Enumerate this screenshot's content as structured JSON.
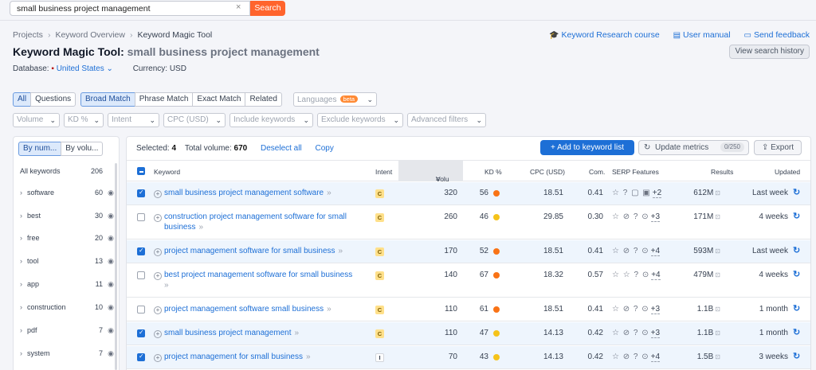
{
  "search": {
    "value": "small business project management",
    "clear": "×",
    "button": "Search"
  },
  "breadcrumb": [
    "Projects",
    "Keyword Overview",
    "Keyword Magic Tool"
  ],
  "links": {
    "course": "Keyword Research course",
    "manual": "User manual",
    "feedback": "Send feedback"
  },
  "title": {
    "prefix": "Keyword Magic Tool:",
    "keyword": "small business project management"
  },
  "history_button": "View search history",
  "database": {
    "label": "Database:",
    "value": "United States",
    "currency": "Currency: USD"
  },
  "match_tabs": [
    "All",
    "Questions",
    "Broad Match",
    "Phrase Match",
    "Exact Match",
    "Related"
  ],
  "languages": {
    "label": "Languages",
    "badge": "beta"
  },
  "filters": [
    "Volume",
    "KD %",
    "Intent",
    "CPC (USD)",
    "Include keywords",
    "Exclude keywords",
    "Advanced filters"
  ],
  "left_tabs": [
    "By num...",
    "By volu..."
  ],
  "left_header": {
    "label": "All keywords",
    "count": "206"
  },
  "groups": [
    {
      "name": "software",
      "count": "60"
    },
    {
      "name": "best",
      "count": "30"
    },
    {
      "name": "free",
      "count": "20"
    },
    {
      "name": "tool",
      "count": "13"
    },
    {
      "name": "app",
      "count": "11"
    },
    {
      "name": "construction",
      "count": "10"
    },
    {
      "name": "pdf",
      "count": "7"
    },
    {
      "name": "system",
      "count": "7"
    }
  ],
  "selection": {
    "selected_label": "Selected:",
    "selected": "4",
    "volume_label": "Total volume:",
    "volume": "670",
    "deselect": "Deselect all",
    "copy": "Copy"
  },
  "buttons": {
    "add": "+ Add to keyword list",
    "update": "Update metrics",
    "update_count": "0/250",
    "export": "Export"
  },
  "columns": [
    "Keyword",
    "Intent",
    "Volu",
    "KD %",
    "CPC (USD)",
    "Com.",
    "SERP Features",
    "Results",
    "Updated"
  ],
  "rows": [
    {
      "kw": "small business project management software",
      "kw2": "",
      "intent": "C",
      "volume": "320",
      "kd": "56",
      "kd_color": "#f97316",
      "cpc": "18.51",
      "com": "0.41",
      "serp": "☆ ? ▢ ▣",
      "more": "+2",
      "results": "612M",
      "updated": "Last week",
      "selected": true
    },
    {
      "kw": "construction project management software for small",
      "kw2": "business",
      "intent": "C",
      "volume": "260",
      "kd": "46",
      "kd_color": "#f5c31a",
      "cpc": "29.85",
      "com": "0.30",
      "serp": "☆ ⊘ ? ⊙",
      "more": "+3",
      "results": "171M",
      "updated": "4 weeks",
      "selected": false
    },
    {
      "kw": "project management software for small business",
      "kw2": "",
      "intent": "C",
      "volume": "170",
      "kd": "52",
      "kd_color": "#f97316",
      "cpc": "18.51",
      "com": "0.41",
      "serp": "☆ ⊘ ? ⊙",
      "more": "+4",
      "results": "593M",
      "updated": "Last week",
      "selected": true
    },
    {
      "kw": "best project management software for small business",
      "kw2": "",
      "intent": "C",
      "volume": "140",
      "kd": "67",
      "kd_color": "#f97316",
      "cpc": "18.32",
      "com": "0.57",
      "serp": "☆ ☆ ? ⊙",
      "more": "+4",
      "results": "479M",
      "updated": "4 weeks",
      "selected": false
    },
    {
      "kw": "project management software small business",
      "kw2": "",
      "intent": "C",
      "volume": "110",
      "kd": "61",
      "kd_color": "#f97316",
      "cpc": "18.51",
      "com": "0.41",
      "serp": "☆ ⊘ ? ⊙",
      "more": "+3",
      "results": "1.1B",
      "updated": "1 month",
      "selected": false
    },
    {
      "kw": "small business project management",
      "kw2": "",
      "intent": "C",
      "volume": "110",
      "kd": "47",
      "kd_color": "#f5c31a",
      "cpc": "14.13",
      "com": "0.42",
      "serp": "☆ ⊘ ? ⊙",
      "more": "+3",
      "results": "1.1B",
      "updated": "1 month",
      "selected": true
    },
    {
      "kw": "project management for small business",
      "kw2": "",
      "intent": "I",
      "volume": "70",
      "kd": "43",
      "kd_color": "#f5c31a",
      "cpc": "14.13",
      "com": "0.42",
      "serp": "☆ ⊘ ? ⊙",
      "more": "+4",
      "results": "1.5B",
      "updated": "3 weeks",
      "selected": true
    }
  ],
  "colors": {
    "accent": "#1d6fd6",
    "search_button": "#ff642d",
    "selected_row": "#eef5fd"
  }
}
